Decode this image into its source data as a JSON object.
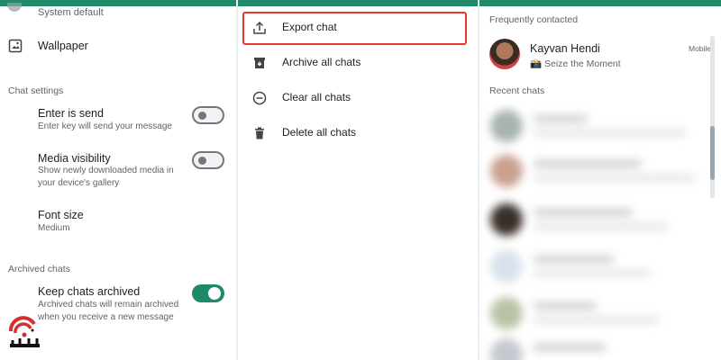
{
  "settings": {
    "system_default": "System default",
    "wallpaper": "Wallpaper",
    "chat_settings_header": "Chat settings",
    "enter_is_send": {
      "title": "Enter is send",
      "subtitle": "Enter key will send your message",
      "enabled": false
    },
    "media_visibility": {
      "title": "Media visibility",
      "subtitle": "Show newly downloaded media in your device's gallery",
      "enabled": false
    },
    "font_size": {
      "title": "Font size",
      "value": "Medium"
    },
    "archived_header": "Archived chats",
    "keep_archived": {
      "title": "Keep chats archived",
      "subtitle": "Archived chats will remain archived when you receive a new message",
      "enabled": true
    }
  },
  "menu": {
    "items": [
      {
        "label": "Export chat",
        "icon": "export-icon"
      },
      {
        "label": "Archive all chats",
        "icon": "archive-icon"
      },
      {
        "label": "Clear all chats",
        "icon": "minus-circle-icon"
      },
      {
        "label": "Delete all chats",
        "icon": "trash-icon"
      }
    ]
  },
  "contacts": {
    "frequent_header": "Frequently contacted",
    "frequent": {
      "name": "Kayvan Hendi",
      "status": "📸 Seize the Moment",
      "tag": "Mobile"
    },
    "recent_header": "Recent chats"
  },
  "colors": {
    "accent": "#1f8a6a",
    "highlight": "#e53935"
  }
}
